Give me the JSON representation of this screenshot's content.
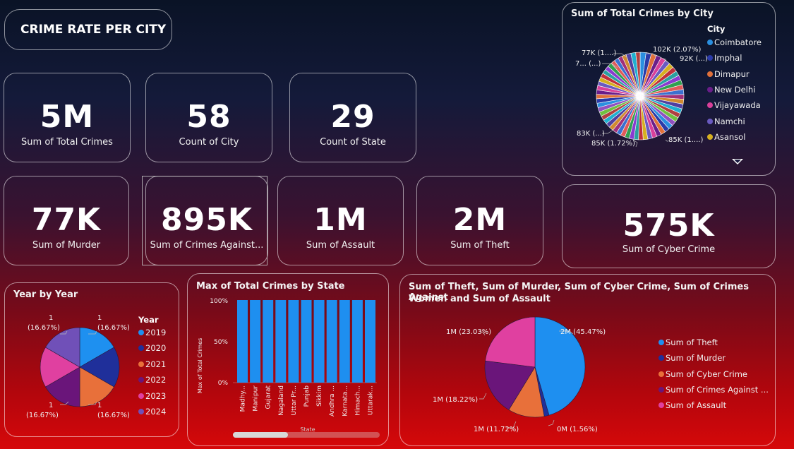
{
  "header": {
    "title": "CRIME RATE PER CITY"
  },
  "kpis": {
    "total_crimes": {
      "value": "5M",
      "label": "Sum of Total Crimes"
    },
    "count_city": {
      "value": "58",
      "label": "Count of City"
    },
    "count_state": {
      "value": "29",
      "label": "Count of State"
    },
    "murder": {
      "value": "77K",
      "label": "Sum of Murder"
    },
    "crimes_against": {
      "value": "895K",
      "label": "Sum of Crimes Against..."
    },
    "assault": {
      "value": "1M",
      "label": "Sum of Assault"
    },
    "theft": {
      "value": "2M",
      "label": "Sum of Theft"
    },
    "cyber": {
      "value": "575K",
      "label": "Sum of Cyber Crime"
    }
  },
  "city_pie": {
    "title": "Sum of Total Crimes by City",
    "legend_title": "City",
    "legend": [
      {
        "label": "Coimbatore",
        "color": "#2a8fe0"
      },
      {
        "label": "Imphal",
        "color": "#2a3aa8"
      },
      {
        "label": "Dimapur",
        "color": "#e0703a"
      },
      {
        "label": "New Delhi",
        "color": "#6a1e8a"
      },
      {
        "label": "Vijayawada",
        "color": "#d8409a"
      },
      {
        "label": "Namchi",
        "color": "#6a5ac0"
      },
      {
        "label": "Asansol",
        "color": "#d6b020"
      }
    ],
    "labels": {
      "l1": "77K (1....)",
      "l2": "7... (...)",
      "l3": "102K (2.07%)",
      "l4": "92K (...)",
      "l5": "83K (...)",
      "l6": "85K (1.72%)",
      "l7": "85K (1....)"
    }
  },
  "year_pie": {
    "title": "Year by Year",
    "legend_title": "Year",
    "legend": [
      {
        "label": "2019",
        "color": "#1e90f0"
      },
      {
        "label": "2020",
        "color": "#1f2f9a"
      },
      {
        "label": "2021",
        "color": "#e8703a"
      },
      {
        "label": "2022",
        "color": "#6a157a"
      },
      {
        "label": "2023",
        "color": "#e040a0"
      },
      {
        "label": "2024",
        "color": "#7050b8"
      }
    ],
    "labels": {
      "tl_a": "1",
      "tl_b": "(16.67%)",
      "tr_a": "1",
      "tr_b": "(16.67%)",
      "bl_a": "1",
      "bl_b": "(16.67%)",
      "br_a": "1",
      "br_b": "(16.67%)"
    }
  },
  "state_bar": {
    "title": "Max of Total Crimes by State",
    "ylabel": "Max of Total Crimes",
    "xlabel": "State",
    "yticks": [
      "100%",
      "50%",
      "0%"
    ],
    "categories": [
      "Madhy...",
      "Manipur",
      "Gujarat",
      "Nagaland",
      "Uttar Pr...",
      "Punjab",
      "Sikkim",
      "Andhra ...",
      "Karnata...",
      "Himach...",
      "Uttarak..."
    ],
    "values": [
      100,
      100,
      100,
      100,
      100,
      100,
      100,
      100,
      100,
      100,
      100
    ],
    "bar_color": "#1e8ff0"
  },
  "crime_pie": {
    "title_line1": "Sum of Theft, Sum of Murder, Sum of Cyber Crime, Sum of Crimes Against",
    "title_line2": "Women and Sum of Assault",
    "legend": [
      {
        "label": "Sum of Theft",
        "color": "#1e8ff0"
      },
      {
        "label": "Sum of Murder",
        "color": "#1f2f9a"
      },
      {
        "label": "Sum of Cyber Crime",
        "color": "#e8703a"
      },
      {
        "label": "Sum of Crimes Against ...",
        "color": "#6a157a"
      },
      {
        "label": "Sum of Assault",
        "color": "#e040a0"
      }
    ],
    "labels": {
      "theft": "2M (45.47%)",
      "murder": "0M (1.56%)",
      "cyber": "1M (11.72%)",
      "against": "1M (18.22%)",
      "assault": "1M (23.03%)"
    }
  },
  "chart_data": [
    {
      "type": "bar",
      "title": "Max of Total Crimes by State",
      "xlabel": "State",
      "ylabel": "Max of Total Crimes",
      "categories": [
        "Madhy...",
        "Manipur",
        "Gujarat",
        "Nagaland",
        "Uttar Pr...",
        "Punjab",
        "Sikkim",
        "Andhra ...",
        "Karnata...",
        "Himach...",
        "Uttarak..."
      ],
      "values": [
        100,
        100,
        100,
        100,
        100,
        100,
        100,
        100,
        100,
        100,
        100
      ],
      "ylim": [
        0,
        100
      ]
    },
    {
      "type": "pie",
      "title": "Year by Year",
      "categories": [
        "2019",
        "2020",
        "2021",
        "2022",
        "2023",
        "2024"
      ],
      "values": [
        1,
        1,
        1,
        1,
        1,
        1
      ]
    },
    {
      "type": "pie",
      "title": "Sum of Theft, Sum of Murder, Sum of Cyber Crime, Sum of Crimes Against Women and Sum of Assault",
      "categories": [
        "Sum of Theft",
        "Sum of Murder",
        "Sum of Cyber Crime",
        "Sum of Crimes Against ...",
        "Sum of Assault"
      ],
      "values": [
        45.47,
        1.56,
        11.72,
        18.22,
        23.03
      ]
    }
  ]
}
